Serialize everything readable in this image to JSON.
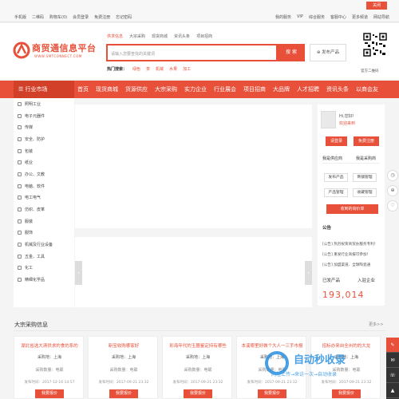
{
  "topbar": {
    "close": "关闭",
    "left": [
      "手机版",
      "二维码",
      "购物车(0)",
      "会员登录",
      "免费注册",
      "忘记密码"
    ],
    "right": [
      "我的服务",
      "VIP",
      "综合服务",
      "客服中心",
      "更多频道",
      "网站导航"
    ]
  },
  "header": {
    "logo_name": "商贸通信息平台",
    "logo_domain": "WWW.SMTCONNECT.COM",
    "search_tabs": [
      "供求信息",
      "大宗采购",
      "现货商城",
      "资讯头条",
      "项目招商"
    ],
    "search_placeholder": "请输入您要查找的关键词",
    "search_button": "搜 索",
    "publish_button": "发布产品",
    "hot_label": "热门搜索：",
    "hot_words": [
      "绿色",
      "茶",
      "机械",
      "水果",
      "加工"
    ],
    "qr_label": "官方二维码"
  },
  "nav": {
    "category_label": "行业市场",
    "items": [
      "首页",
      "现货商城",
      "货源供应",
      "大宗采购",
      "实力企业",
      "行业展会",
      "项目招商",
      "大品牌",
      "人才招聘",
      "资讯头条",
      "以商会友"
    ]
  },
  "categories": [
    "照明工业",
    "电子元器件",
    "传媒",
    "安全、防护",
    "包装",
    "纸业",
    "办公、文教",
    "电脑、软件",
    "电工电气",
    "仿织、皮革",
    "服装",
    "服饰",
    "机械及行业设备",
    "五金、工具",
    "化工",
    "精细化学品"
  ],
  "user_panel": {
    "hi": "Hi,您好!",
    "welcome": "欢迎来到",
    "login": "请登录",
    "register": "免费注册",
    "tab_supply": "我是供应商",
    "tab_buyer": "我是采购商",
    "buttons": [
      "发布产品",
      "商铺管理",
      "产品管理",
      "收藏管理"
    ],
    "supply_button": "收到的询价单",
    "notice_title": "公告",
    "notices": [
      "[公告] 热烈祝贺商贸办服务专利！",
      "[公告] 重发行业商报可参加！",
      "[公告] 加盟渠道、全球陶瓷通"
    ],
    "stat_label_products": "已发产品",
    "stat_label_companies": "入驻企业",
    "stat_value": "193,014"
  },
  "bulk": {
    "title": "大宗采购信息",
    "more": "更多>>",
    "cards": [
      {
        "title": "湖北省选大清供求的食的系的",
        "location": "采购地：上海",
        "quantity": "采购数量：电联",
        "time": "发布时间：2017-12-16 14:57",
        "button": "我要报价"
      },
      {
        "title": "新宝收购哪家好",
        "location": "采购地：上海",
        "quantity": "采购数量：电联",
        "time": "发布时间：2017-09-21 23:32",
        "button": "我要报价"
      },
      {
        "title": "彩海年代的玉器鉴定持有哪些",
        "location": "采购地：上海",
        "quantity": "采购数量：电联",
        "time": "发布时间：2017-09-21 23:32",
        "button": "我要报价"
      },
      {
        "title": "本溪哪里好做个大人一三手市报",
        "location": "采购地：上海",
        "quantity": "采购数量：电联",
        "time": "发布时间：2017-09-21 23:32",
        "button": "我要报价"
      },
      {
        "title": "招标办来自全州的的大龙",
        "location": "采购地：上海",
        "quantity": "采购数量：电联",
        "time": "发布时间：2017-09-21 23:32",
        "button": "我要报价"
      }
    ]
  },
  "watermark": {
    "text": "自动秒收录",
    "sub": "网址上传→来访一次→自动收录"
  },
  "colors": {
    "accent": "#e8503a",
    "accent_dark": "#d2402a",
    "watermark": "#2a8fe0"
  }
}
